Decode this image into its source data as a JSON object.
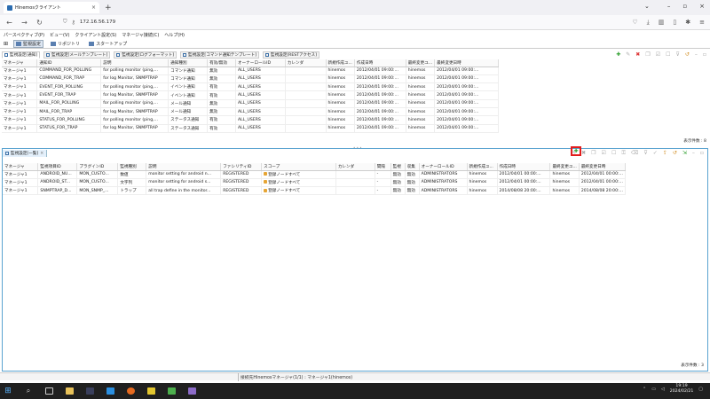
{
  "browser": {
    "tab_title": "Hinemosクライアント",
    "url": "172.16.56.179",
    "newtab": "+",
    "close": "×"
  },
  "menu": [
    "パースペクティブ(P)",
    "ビュー(V)",
    "クライアント設定(S)",
    "マネージャ接続(C)",
    "ヘルプ(H)"
  ],
  "perspectives": [
    "監視設定",
    "リポジトリ",
    "スタートアップ"
  ],
  "view_tabs": [
    "監視設定[通知]",
    "監視設定[メールテンプレート]",
    "監視設定[ログフォーマット]",
    "監視設定[コマンド通知テンプレート]",
    "監視設定[RESTアクセス]"
  ],
  "upper_table": {
    "columns": [
      "マネージャ",
      "通知ID",
      "説明",
      "通知種別",
      "有効/無効",
      "オーナーロールID",
      "カレンダ",
      "新規作成ユ...",
      "作成日時",
      "最終変更ユ...",
      "最終変更日時"
    ],
    "rows": [
      [
        "マネージャ1",
        "COMMAND_FOR_POLLING",
        "for polling monitor (ping,...",
        "コマンド通知",
        "無効",
        "ALL_USERS",
        "",
        "hinemos",
        "2012/04/01 09:00:...",
        "hinemos",
        "2012/04/01 09:00:..."
      ],
      [
        "マネージャ1",
        "COMMAND_FOR_TRAP",
        "for log Monitor, SNMPTRAP",
        "コマンド通知",
        "無効",
        "ALL_USERS",
        "",
        "hinemos",
        "2012/04/01 09:00:...",
        "hinemos",
        "2012/04/01 09:00:..."
      ],
      [
        "マネージャ1",
        "EVENT_FOR_POLLING",
        "for polling monitor (ping,...",
        "イベント通知",
        "有効",
        "ALL_USERS",
        "",
        "hinemos",
        "2012/04/01 09:00:...",
        "hinemos",
        "2012/04/01 09:00:..."
      ],
      [
        "マネージャ1",
        "EVENT_FOR_TRAP",
        "for log Monitor, SNMPTRAP",
        "イベント通知",
        "有効",
        "ALL_USERS",
        "",
        "hinemos",
        "2012/04/01 09:00:...",
        "hinemos",
        "2012/04/01 09:00:..."
      ],
      [
        "マネージャ1",
        "MAIL_FOR_POLLING",
        "for polling monitor (ping,...",
        "メール通知",
        "無効",
        "ALL_USERS",
        "",
        "hinemos",
        "2012/04/01 09:00:...",
        "hinemos",
        "2012/04/01 09:00:..."
      ],
      [
        "マネージャ1",
        "MAIL_FOR_TRAP",
        "for log Monitor, SNMPTRAP",
        "メール通知",
        "無効",
        "ALL_USERS",
        "",
        "hinemos",
        "2012/04/01 09:00:...",
        "hinemos",
        "2012/04/01 09:00:..."
      ],
      [
        "マネージャ1",
        "STATUS_FOR_POLLING",
        "for polling monitor (ping,...",
        "ステータス通知",
        "有効",
        "ALL_USERS",
        "",
        "hinemos",
        "2012/04/01 09:00:...",
        "hinemos",
        "2012/04/01 09:00:..."
      ],
      [
        "マネージャ1",
        "STATUS_FOR_TRAP",
        "for log Monitor, SNMPTRAP",
        "ステータス通知",
        "有効",
        "ALL_USERS",
        "",
        "hinemos",
        "2012/04/01 09:00:...",
        "hinemos",
        "2012/04/01 09:00:..."
      ]
    ],
    "count": "表示件数 : 8"
  },
  "lower": {
    "tab_title": "監視設定[一覧]",
    "columns": [
      "マネージャ",
      "監視項目ID",
      "プラグインID",
      "監視種別",
      "説明",
      "ファシリティID",
      "スコープ",
      "カレンダ",
      "間隔",
      "監視",
      "収集",
      "オーナーロールID",
      "新規作成ユ...",
      "作成日時",
      "最終変更ユ...",
      "最終変更日時"
    ],
    "rows": [
      [
        "マネージャ1",
        "ANDROID_NU...",
        "MON_CUSTO...",
        "数値",
        "monitor setting for android n...",
        "REGISTERED",
        "登録ノードすべて",
        "",
        "-",
        "無効",
        "無効",
        "ADMINISTRATORS",
        "hinemos",
        "2012/04/01 00:00:...",
        "hinemos",
        "2012/04/01 00:00:..."
      ],
      [
        "マネージャ1",
        "ANDROID_ST...",
        "MON_CUSTO...",
        "文字列",
        "monitor setting for android s...",
        "REGISTERED",
        "登録ノードすべて",
        "",
        "-",
        "無効",
        "無効",
        "ADMINISTRATORS",
        "hinemos",
        "2012/04/01 00:00:...",
        "hinemos",
        "2012/04/01 00:00:..."
      ],
      [
        "マネージャ1",
        "SNMPTRAP_D...",
        "MON_SNMP_...",
        "トラップ",
        "all trap define in the monitor...",
        "REGISTERED",
        "登録ノードすべて",
        "",
        "-",
        "無効",
        "無効",
        "ADMINISTRATORS",
        "hinemos",
        "2014/08/08 20:00:...",
        "hinemos",
        "2014/08/08 20:00:..."
      ]
    ],
    "count": "表示件数 : 3"
  },
  "status_text": "接続先Hinemosマネージャ(1/1) : マネージャ1(hinemos)",
  "clock": {
    "time": "19:19",
    "date": "2024/02/21"
  }
}
